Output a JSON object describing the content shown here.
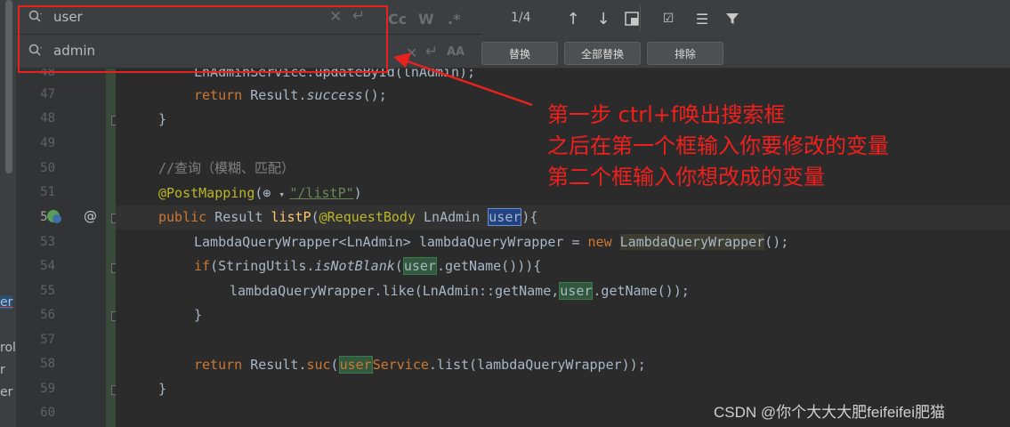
{
  "find": {
    "search_value": "user",
    "replace_value": "admin",
    "match_count": "1/4",
    "opt_case": "Cc",
    "opt_words": "W",
    "opt_regex": ".*",
    "opt_preserve_case": "AA",
    "replace_label": "替换",
    "replace_all_label": "全部替换",
    "exclude_label": "排除"
  },
  "left_panel": [
    "er",
    "rol",
    "r",
    "er"
  ],
  "gutter": {
    "lines": [
      "48",
      "47",
      "48",
      "49",
      "50",
      "51",
      "52",
      "53",
      "54",
      "55",
      "56",
      "57",
      "58",
      "59",
      "60"
    ]
  },
  "code": {
    "l46": "LnAdminService.updateById(lnAdmin);",
    "l47_kw": "return",
    "l47_a": " Result.",
    "l47_m": "success",
    "l47_b": "();",
    "l48": "}",
    "l50": "//查询（模糊、匹配）",
    "l51_ann": "@PostMapping",
    "l51_a": "(",
    "l51_str": "\"/listP\"",
    "l51_b": ")",
    "l52_kw": "public",
    "l52_a": " Result ",
    "l52_fn": "listP",
    "l52_b": "(",
    "l52_ann": "@RequestBody",
    "l52_c": " LnAdmin ",
    "l52_user": "user",
    "l52_d": "){",
    "l53_a": "LambdaQueryWrapper<LnAdmin> lambdaQueryWrapper = ",
    "l53_kw": "new",
    "l53_sp": " ",
    "l53_cls": "LambdaQueryWrapper",
    "l53_b": "();",
    "l54_kw": "if",
    "l54_a": "(StringUtils.",
    "l54_m": "isNotBlank",
    "l54_b": "(",
    "l54_user": "user",
    "l54_c": ".getName())){",
    "l55_a": "lambdaQueryWrapper.like(LnAdmin::getName,",
    "l55_user": "user",
    "l55_b": ".getName());",
    "l56": "}",
    "l58_kw": "return",
    "l58_a": " Result.",
    "l58_m": "suc",
    "l58_b": "(",
    "l58_user": "user",
    "l58_svc": "Service",
    "l58_c": ".list(lambdaQueryWrapper));",
    "l59": "}"
  },
  "annotation": {
    "line1": "第一步 ctrl+f唤出搜索框",
    "line2": "之后在第一个框输入你要修改的变量",
    "line3": "第二个框输入你想改成的变量"
  },
  "watermark": "CSDN @你个大大大肥feifeifei肥猫",
  "colors": {
    "annotation_red": "#e8221e",
    "match_green": "#32593d",
    "selection_blue": "#214283"
  }
}
